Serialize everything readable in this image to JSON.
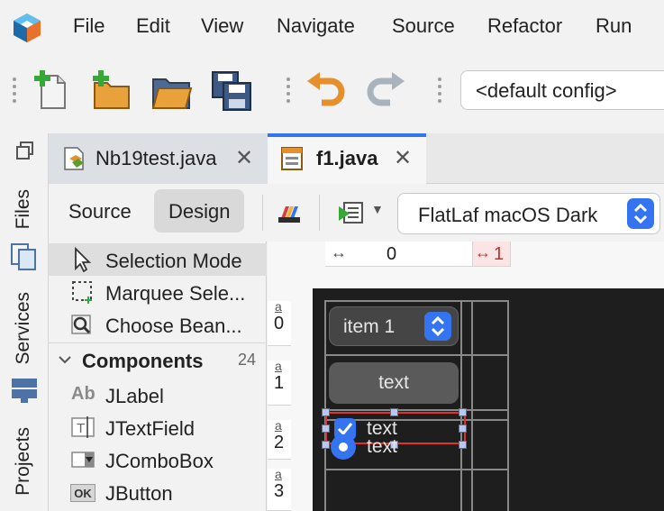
{
  "menubar": {
    "items": [
      "File",
      "Edit",
      "View",
      "Navigate",
      "Source",
      "Refactor",
      "Run"
    ]
  },
  "toolbar": {
    "buttons": [
      "new-file-icon",
      "new-project-icon",
      "open-project-icon",
      "save-all-icon",
      "undo-icon",
      "redo-icon"
    ],
    "config_value": "<default config>"
  },
  "side_tabs": [
    "Files",
    "Services",
    "Projects"
  ],
  "editor_tabs": [
    {
      "label": "Nb19test.java",
      "active": false
    },
    {
      "label": "f1.java",
      "active": true
    }
  ],
  "editor_toolbar": {
    "source_label": "Source",
    "design_label": "Design",
    "laf_value": "FlatLaf macOS Dark"
  },
  "palette": {
    "modes": [
      "Selection Mode",
      "Marquee Sele...",
      "Choose Bean..."
    ],
    "category": "Components",
    "category_count": "24",
    "components": [
      {
        "label": "JLabel",
        "icon_text": "Ab"
      },
      {
        "label": "JTextField",
        "icon_text": "T"
      },
      {
        "label": "JComboBox",
        "icon_text": ""
      },
      {
        "label": "JButton",
        "icon_text": "OK"
      }
    ]
  },
  "design": {
    "col_ruler": [
      "0",
      "1"
    ],
    "row_ruler": [
      {
        "a": "a",
        "n": "0"
      },
      {
        "a": "a",
        "n": "1"
      },
      {
        "a": "a",
        "n": "2"
      },
      {
        "a": "a",
        "n": "3"
      }
    ],
    "combo_value": "item 1",
    "button_label": "text",
    "checkbox_label": "text",
    "radio_label": "text"
  },
  "colors": {
    "accent": "#3574f0",
    "canvas_bg": "#1e1e1e",
    "selection_border": "#e03030"
  }
}
